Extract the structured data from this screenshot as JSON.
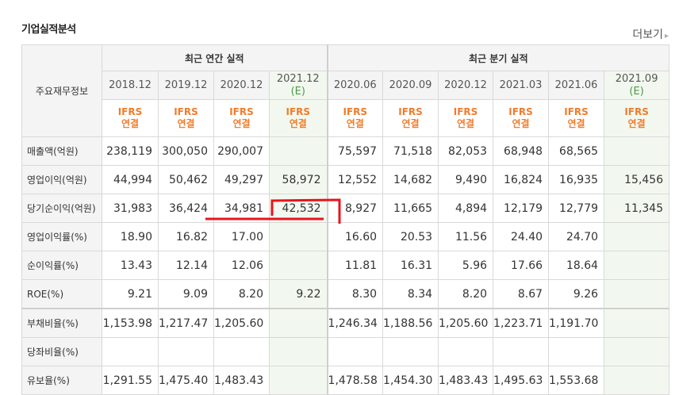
{
  "section_title": "기업실적분석",
  "more_link": "더보기",
  "header": {
    "label_col": "주요재무정보",
    "annual_group": "최근 연간 실적",
    "quarter_group": "최근 분기 실적",
    "annual_periods": [
      "2018.12",
      "2019.12",
      "2020.12",
      "2021.12"
    ],
    "annual_estimate_flag": "(E)",
    "quarter_periods": [
      "2020.06",
      "2020.09",
      "2020.12",
      "2021.03",
      "2021.06",
      "2021.09"
    ],
    "quarter_estimate_flag": "(E)",
    "ifrs_line1": "IFRS",
    "ifrs_line2": "연결"
  },
  "rows": [
    {
      "label": "매출액(억원)",
      "values": [
        "238,119",
        "300,050",
        "290,007",
        "",
        "75,597",
        "71,518",
        "82,053",
        "68,948",
        "68,565",
        ""
      ]
    },
    {
      "label": "영업이익(억원)",
      "values": [
        "44,994",
        "50,462",
        "49,297",
        "58,972",
        "12,552",
        "14,682",
        "9,490",
        "16,824",
        "16,935",
        "15,456"
      ]
    },
    {
      "label": "당기순이익(억원)",
      "values": [
        "31,983",
        "36,424",
        "34,981",
        "42,532",
        "8,927",
        "11,665",
        "4,894",
        "12,179",
        "12,779",
        "11,345"
      ]
    },
    {
      "label": "영업이익률(%)",
      "values": [
        "18.90",
        "16.82",
        "17.00",
        "",
        "16.60",
        "20.53",
        "11.56",
        "24.40",
        "24.70",
        ""
      ]
    },
    {
      "label": "순이익률(%)",
      "values": [
        "13.43",
        "12.14",
        "12.06",
        "",
        "11.81",
        "16.31",
        "5.96",
        "17.66",
        "18.64",
        ""
      ]
    },
    {
      "label": "ROE(%)",
      "values": [
        "9.21",
        "9.09",
        "8.20",
        "9.22",
        "8.30",
        "8.34",
        "8.20",
        "8.67",
        "9.26",
        ""
      ]
    },
    {
      "label": "부채비율(%)",
      "values": [
        "1,153.98",
        "1,217.47",
        "1,205.60",
        "",
        "1,246.34",
        "1,188.56",
        "1,205.60",
        "1,223.71",
        "1,191.70",
        ""
      ]
    },
    {
      "label": "당좌비율(%)",
      "values": [
        "",
        "",
        "",
        "",
        "",
        "",
        "",
        "",
        "",
        ""
      ]
    },
    {
      "label": "유보율(%)",
      "values": [
        "1,291.55",
        "1,475.40",
        "1,483.43",
        "",
        "1,478.58",
        "1,454.30",
        "1,483.43",
        "1,495.63",
        "1,553.68",
        ""
      ]
    }
  ],
  "colors": {
    "ifrs": "#f07c2c",
    "estimate_text": "#4a9a4a",
    "estimate_bg": "#f2f8ef",
    "header_bg": "#f4f4f4",
    "annotation": "#e8141c"
  }
}
